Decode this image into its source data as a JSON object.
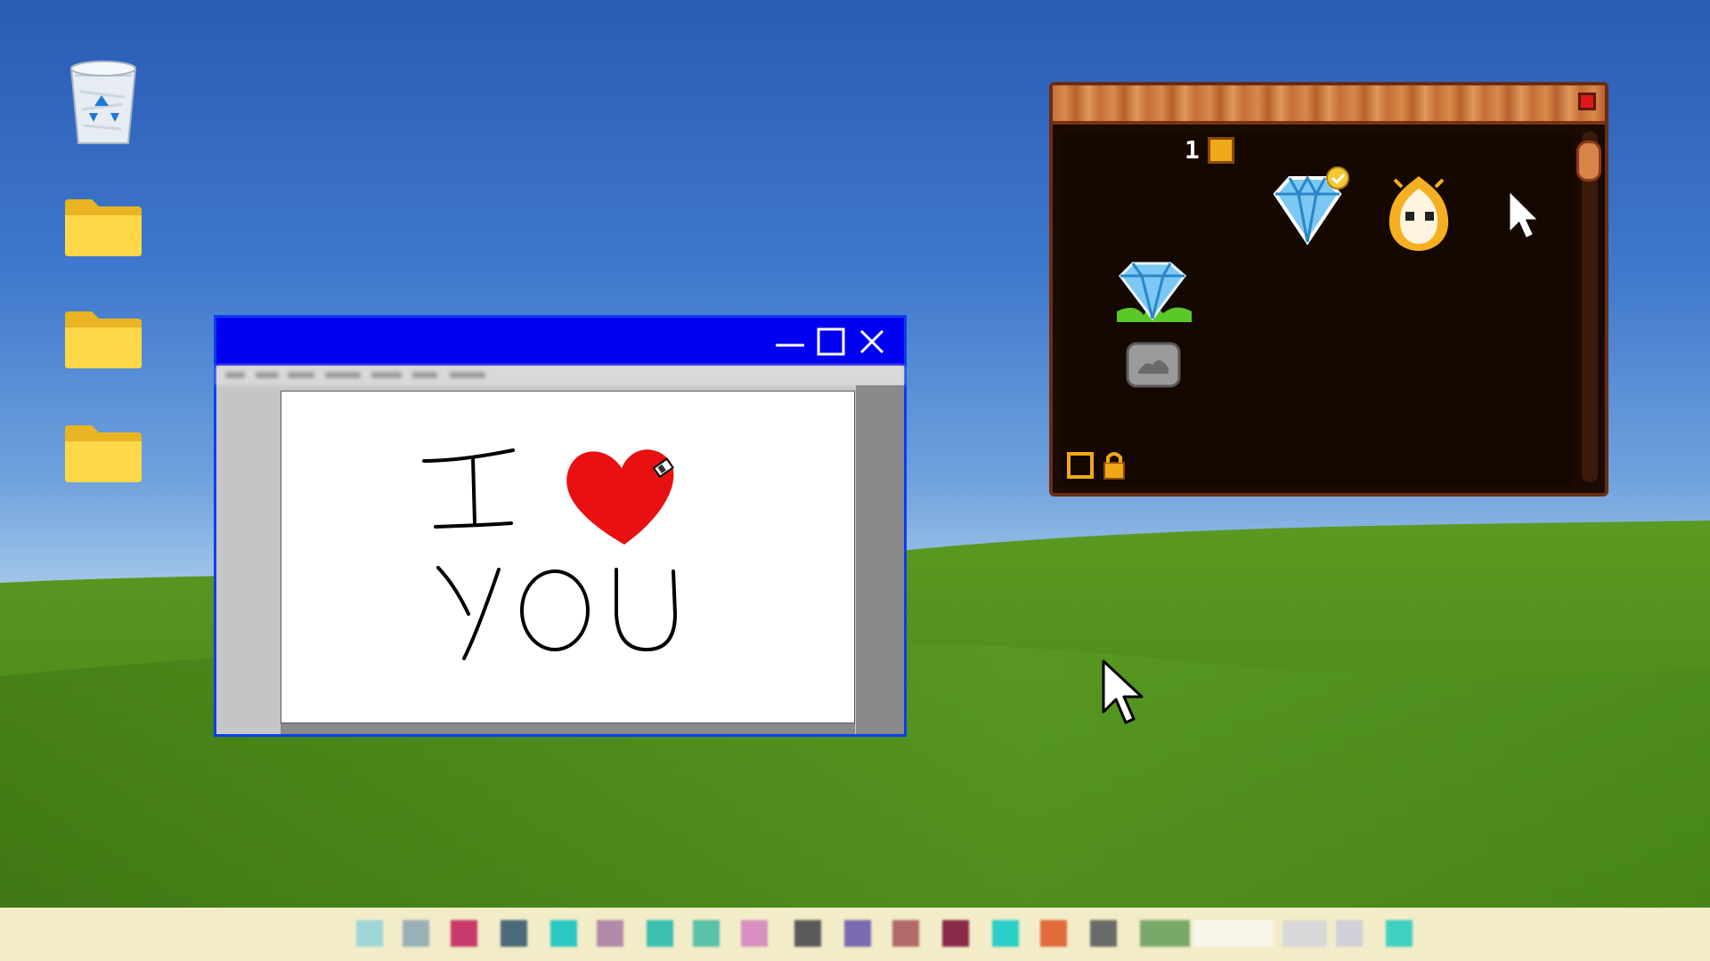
{
  "desktop": {
    "icons": [
      {
        "name": "recycle-bin",
        "icon": "recycle-bin-icon"
      },
      {
        "name": "folder-1",
        "icon": "folder-icon"
      },
      {
        "name": "folder-2",
        "icon": "folder-icon"
      },
      {
        "name": "folder-3",
        "icon": "folder-icon"
      }
    ],
    "wallpaper": {
      "sky": "#3f78cc",
      "grass": "#4f8a1c"
    }
  },
  "paint_window": {
    "titlebar_color": "#0000f0",
    "buttons": [
      "minimize-icon",
      "maximize-icon",
      "close-icon"
    ],
    "canvas_text": {
      "line1": "I",
      "line2": "YOU"
    },
    "heart_color": "#e81010"
  },
  "inventory": {
    "count": "1",
    "colors": {
      "frame": "#6b2d10",
      "title_wood": "#c8703a",
      "body": "#140800",
      "close": "#e01818"
    },
    "items": [
      {
        "name": "diamond-selected",
        "icon": "diamond-icon",
        "checked": true
      },
      {
        "name": "fire-mask",
        "icon": "fire-mask-icon"
      },
      {
        "name": "diamond-plant",
        "icon": "diamond-plant-icon"
      },
      {
        "name": "stone-tile",
        "icon": "stone-icon"
      }
    ],
    "footer_icons": [
      "empty-slot-icon",
      "lock-icon"
    ]
  },
  "taskbar": {
    "background": "#f3ecc8",
    "pinned_apps": 22
  }
}
